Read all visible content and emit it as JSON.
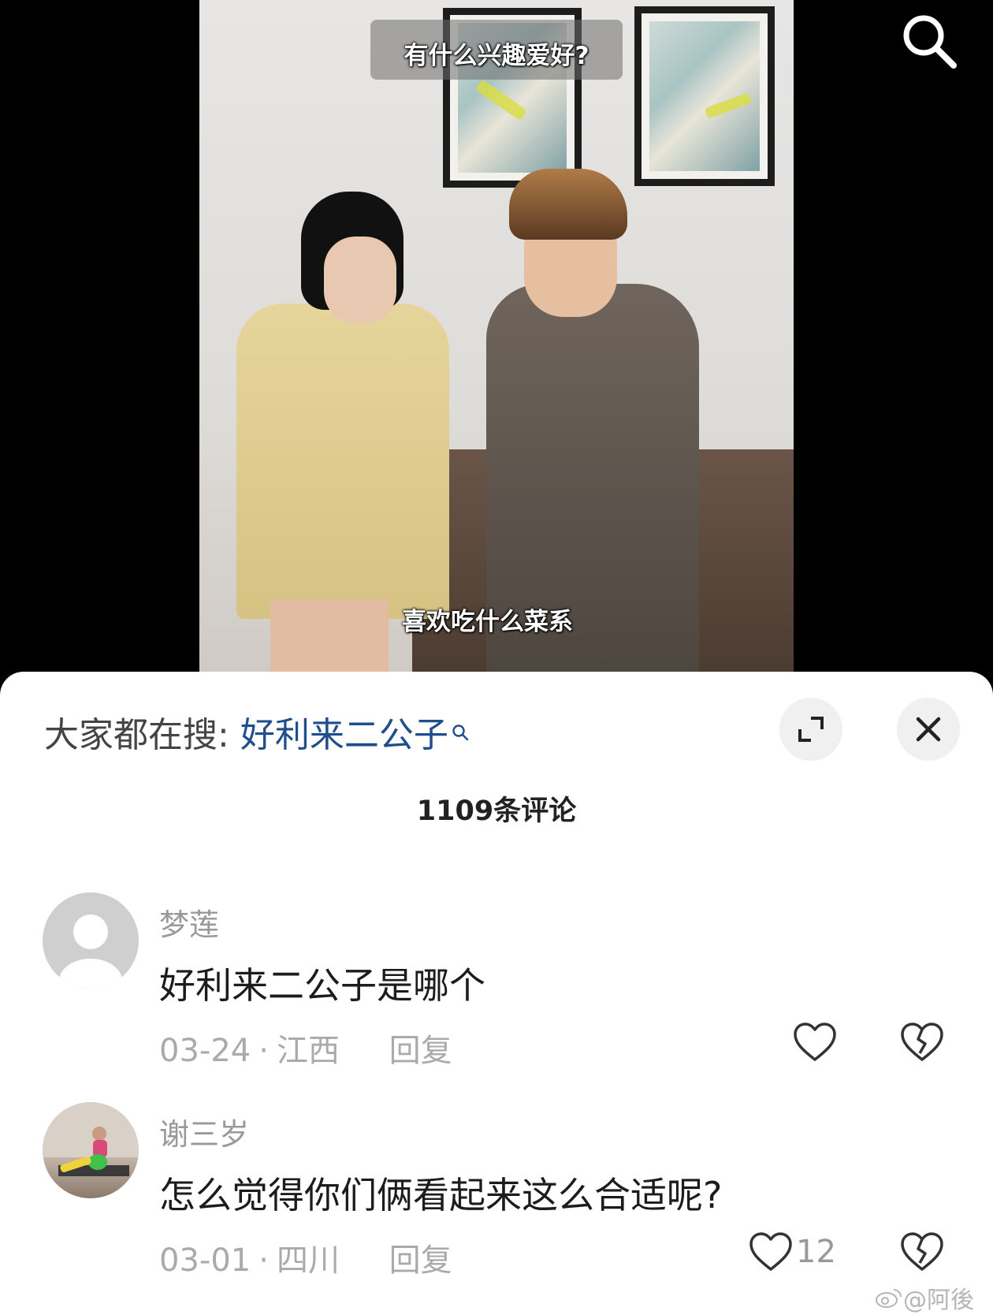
{
  "video": {
    "subtitle_top": "有什么兴趣爱好?",
    "subtitle_bottom": "喜欢吃什么菜系"
  },
  "hot_search": {
    "prefix": "大家都在搜:",
    "keyword": "好利来二公子"
  },
  "comments_header": {
    "count_label": "1109条评论"
  },
  "comments": [
    {
      "username": "梦莲",
      "text": "好利来二公子是哪个",
      "date": "03-24",
      "separator": "·",
      "location": "江西",
      "reply_label": "回复",
      "likes": ""
    },
    {
      "username": "谢三岁",
      "text": "怎么觉得你们俩看起来这么合适呢?",
      "date": "03-01",
      "separator": "·",
      "location": "四川",
      "reply_label": "回复",
      "likes": "12"
    }
  ],
  "watermark": "@阿後",
  "icons": {
    "search": "search-icon",
    "expand": "expand-icon",
    "close": "close-icon",
    "like": "heart-icon",
    "dislike": "broken-heart-icon"
  }
}
